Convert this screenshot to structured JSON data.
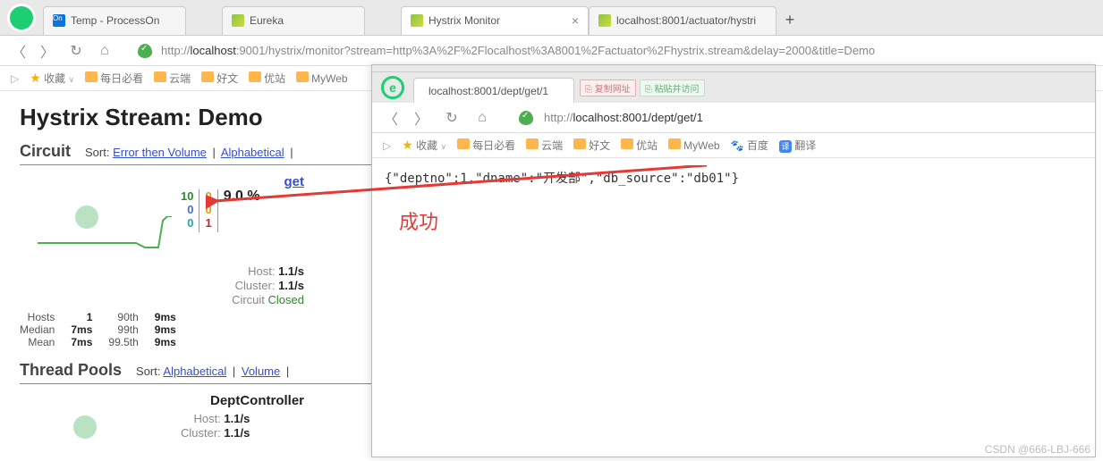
{
  "tabs": [
    {
      "label": "Temp - ProcessOn",
      "fav": "on"
    },
    {
      "label": "Eureka",
      "fav": "leaf"
    },
    {
      "label": "Hystrix Monitor",
      "fav": "leaf",
      "active": true
    },
    {
      "label": "localhost:8001/actuator/hystri",
      "fav": "leaf"
    }
  ],
  "topnav": {
    "url_prefix": "http://",
    "url_domain": "localhost",
    "url_rest": ":9001/hystrix/monitor?stream=http%3A%2F%2Flocalhost%3A8001%2Factuator%2Fhystrix.stream&delay=2000&title=Demo"
  },
  "bookmarks": {
    "fav_label": "收藏",
    "items": [
      "每日必看",
      "云端",
      "好文",
      "优站",
      "MyWeb"
    ]
  },
  "dashboard": {
    "title": "Hystrix Stream: Demo",
    "circuit_heading": "Circuit",
    "sort_label": "Sort:",
    "sort_links": [
      "Error then Volume",
      "Alphabetical"
    ],
    "circuit": {
      "name": "get",
      "colA": [
        "10",
        "0",
        "0"
      ],
      "colB": [
        "0",
        "0",
        "1"
      ],
      "error_pct": "9.0 %",
      "host_label": "Host:",
      "host_rate": "1.1/s",
      "cluster_label": "Cluster:",
      "cluster_rate": "1.1/s",
      "circuit_label": "Circuit",
      "circuit_state": "Closed",
      "hosts_label": "Hosts",
      "hosts_val": "1",
      "median_label": "Median",
      "median_val": "7ms",
      "mean_label": "Mean",
      "mean_val": "7ms",
      "p90_label": "90th",
      "p90_val": "9ms",
      "p99_label": "99th",
      "p99_val": "9ms",
      "p995_label": "99.5th",
      "p995_val": "9ms"
    },
    "pool_heading": "Thread Pools",
    "pool_sort_links": [
      "Alphabetical",
      "Volume"
    ],
    "pool": {
      "name": "DeptController",
      "host_label": "Host:",
      "host_rate": "1.1/s",
      "cluster_label": "Cluster:",
      "cluster_rate": "1.1/s"
    }
  },
  "win2": {
    "tab_label": "localhost:8001/dept/get/1",
    "badge1": "⎘ 复制网址",
    "badge2": "⎘ 粘贴并访问",
    "url_prefix": "http://",
    "url_domain": "localhost",
    "url_rest": ":8001/dept/get/1",
    "bookmarks": {
      "fav_label": "收藏",
      "items": [
        "每日必看",
        "云端",
        "好文",
        "优站",
        "MyWeb"
      ],
      "extra": [
        "百度",
        "翻译"
      ]
    },
    "response_text": "{\"deptno\":1,\"dname\":\"开发部\",\"db_source\":\"db01\"}",
    "annotation": "成功"
  },
  "watermark": "CSDN @666-LBJ-666"
}
